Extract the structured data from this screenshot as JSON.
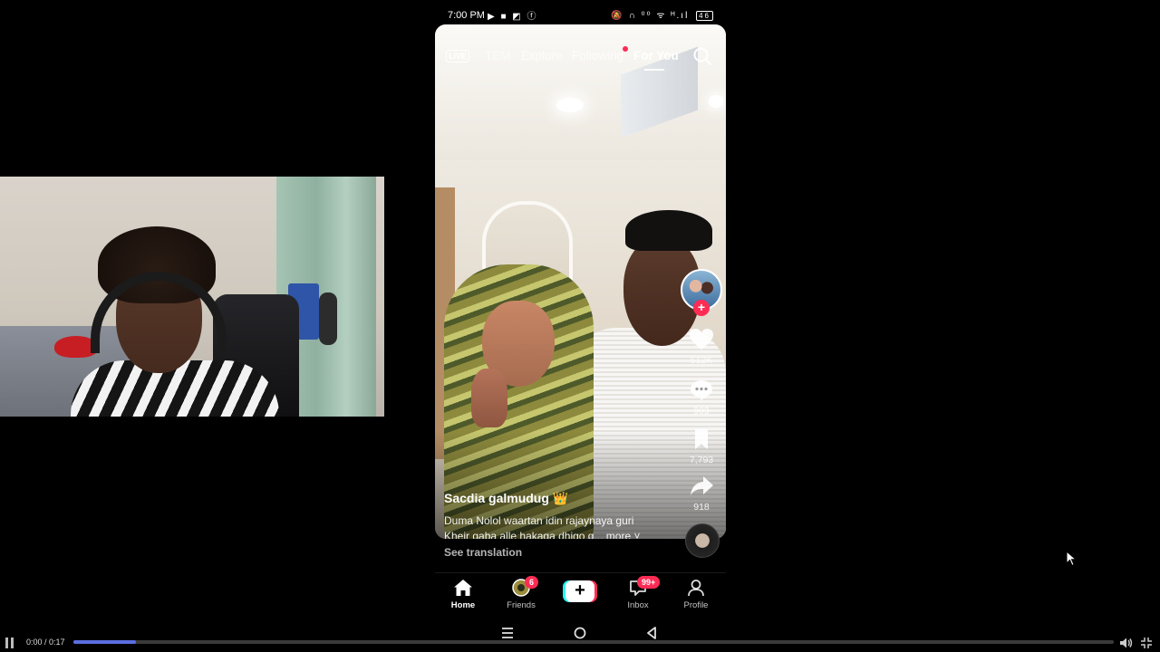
{
  "status": {
    "time": "7:00 PM",
    "left_icons": "▶ ■ ◩ ⓕ",
    "right_icons": "🔕 ∩ ⁰⁰ ᯤ ᴴ.ıl",
    "battery": "46"
  },
  "top_nav": {
    "live_label": "LIVE",
    "tabs": [
      "TEM",
      "Explore",
      "Following",
      "For You"
    ],
    "active_tab": "For You"
  },
  "rail": {
    "likes": "512K",
    "comments": "903",
    "saves": "7,793",
    "shares": "918"
  },
  "post": {
    "username": "Sacdia galmudug",
    "username_emoji": "👑",
    "caption_line1": "Duma Nolol waartan idin rajaynaya  guri",
    "caption_line2": "Kheir qaba alle hakaga dhigo g... more ˅",
    "see_translation": "See translation"
  },
  "bottom_nav": {
    "home": "Home",
    "friends": "Friends",
    "friends_badge": "6",
    "inbox": "Inbox",
    "inbox_badge": "99+",
    "profile": "Profile"
  },
  "player": {
    "time": "0:00 / 0:17",
    "progress": 0.06
  },
  "colors": {
    "accent_red": "#fe2c55",
    "accent_cyan": "#25f4ee",
    "progress": "#5b6ee1"
  }
}
